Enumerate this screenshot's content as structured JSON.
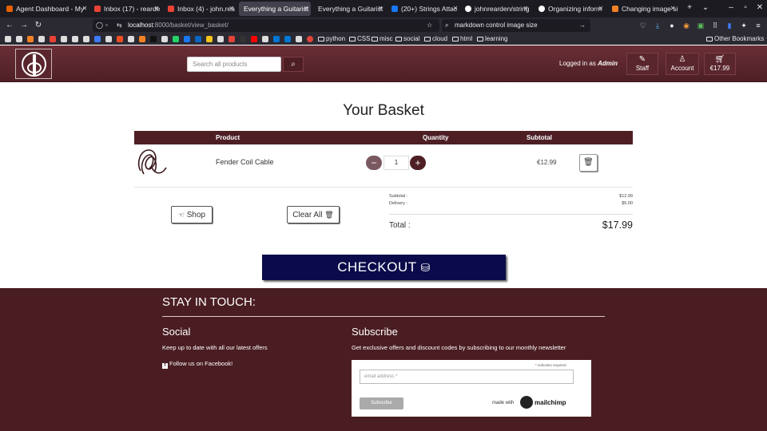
{
  "browser": {
    "tabs": [
      {
        "title": "Agent Dashboard - My",
        "favicon_color": "#e66000"
      },
      {
        "title": "Inbox (17) - rearde",
        "favicon_color": "#ea4335"
      },
      {
        "title": "Inbox (4) - john.rea",
        "favicon_color": "#ea4335"
      },
      {
        "title": "Everything a Guitarist",
        "favicon_color": "#6b2f37",
        "active": true
      },
      {
        "title": "Everything a Guitarist",
        "favicon_color": "#6b2f37"
      },
      {
        "title": "(20+) Strings Attac",
        "favicon_color": "#1877f2"
      },
      {
        "title": "johnrearden/string",
        "favicon_color": "#ffffff"
      },
      {
        "title": "Organizing inform",
        "favicon_color": "#ffffff"
      },
      {
        "title": "Changing image si",
        "favicon_color": "#f48024"
      }
    ],
    "new_tab": "+",
    "url_host": "localhost",
    "url_path": ":8000/basket/view_basket/",
    "search_text": "markdown control image size",
    "bookmark_folders": [
      "python",
      "CSS",
      "misc",
      "social",
      "cloud",
      "html",
      "learning"
    ],
    "other_bookmarks": "Other Bookmarks"
  },
  "header": {
    "search_placeholder": "Search all products",
    "login_prefix": "Logged in as",
    "login_user": "Admin",
    "staff_label": "Staff",
    "account_label": "Account",
    "basket_total": "€17.99"
  },
  "basket": {
    "title": "Your Basket",
    "columns": {
      "product": "Product",
      "quantity": "Quantity",
      "subtotal": "Subtotal"
    },
    "items": [
      {
        "name": "Fender Coil Cable",
        "quantity": "1",
        "subtotal": "€12.99"
      }
    ],
    "shop_label": "Shop",
    "clear_all_label": "Clear All",
    "summary": {
      "subtotal_label": "Subtotal :",
      "subtotal_value": "$12.99",
      "delivery_label": "Delivery :",
      "delivery_value": "$5.00",
      "total_label": "Total :",
      "total_value": "$17.99"
    },
    "checkout_label": "CHECKOUT"
  },
  "footer": {
    "title": "STAY IN TOUCH:",
    "social_heading": "Social",
    "social_text": "Keep up to date with all our latest offers",
    "facebook_link": "Follow us on Facebook!",
    "subscribe_heading": "Subscribe",
    "subscribe_text": "Get exclusive offers and discount codes by subscribing to our monthly newsletter",
    "required_note": "indicates required",
    "email_placeholder": "email address *",
    "subscribe_button": "Subscribe",
    "made_with": "made with",
    "mailchimp": "mailchimp"
  },
  "colors": {
    "brand": "#4d1f25",
    "checkout": "#0b0a4a",
    "footer": "#4a1d22"
  }
}
